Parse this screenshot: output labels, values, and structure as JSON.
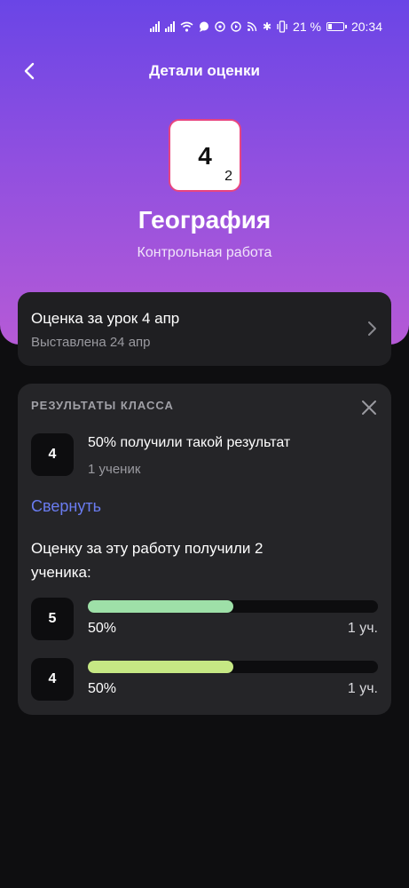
{
  "status_bar": {
    "battery": "21 %",
    "time": "20:34"
  },
  "header": {
    "title": "Детали оценки",
    "back_icon": "chevron-left-icon"
  },
  "grade": {
    "value": "4",
    "weight": "2",
    "border_color": "#e8457f"
  },
  "subject": {
    "name": "География",
    "work_type": "Контрольная работа"
  },
  "lesson": {
    "title": "Оценка за урок 4 апр",
    "subtitle": "Выставлена 24 апр",
    "icon": "chevron-right-icon"
  },
  "results": {
    "title": "РЕЗУЛЬТАТЫ КЛАССА",
    "close_icon": "close-icon",
    "same": {
      "grade": "4",
      "text": "50% получили такой результат",
      "count": "1 ученик"
    },
    "collapse_label": "Свернуть",
    "distribution_title": "Оценку за эту работу получили 2 ученика:",
    "rows": [
      {
        "grade": "5",
        "percent_label": "50%",
        "count": "1 уч.",
        "fraction": 0.5,
        "color": "#9ee0a8"
      },
      {
        "grade": "4",
        "percent_label": "50%",
        "count": "1 уч.",
        "fraction": 0.5,
        "color": "#c6e884"
      }
    ]
  },
  "colors": {
    "accent": "#6a7cf0",
    "gradient_top": "#6a45e6",
    "gradient_bottom": "#b55ad6"
  }
}
